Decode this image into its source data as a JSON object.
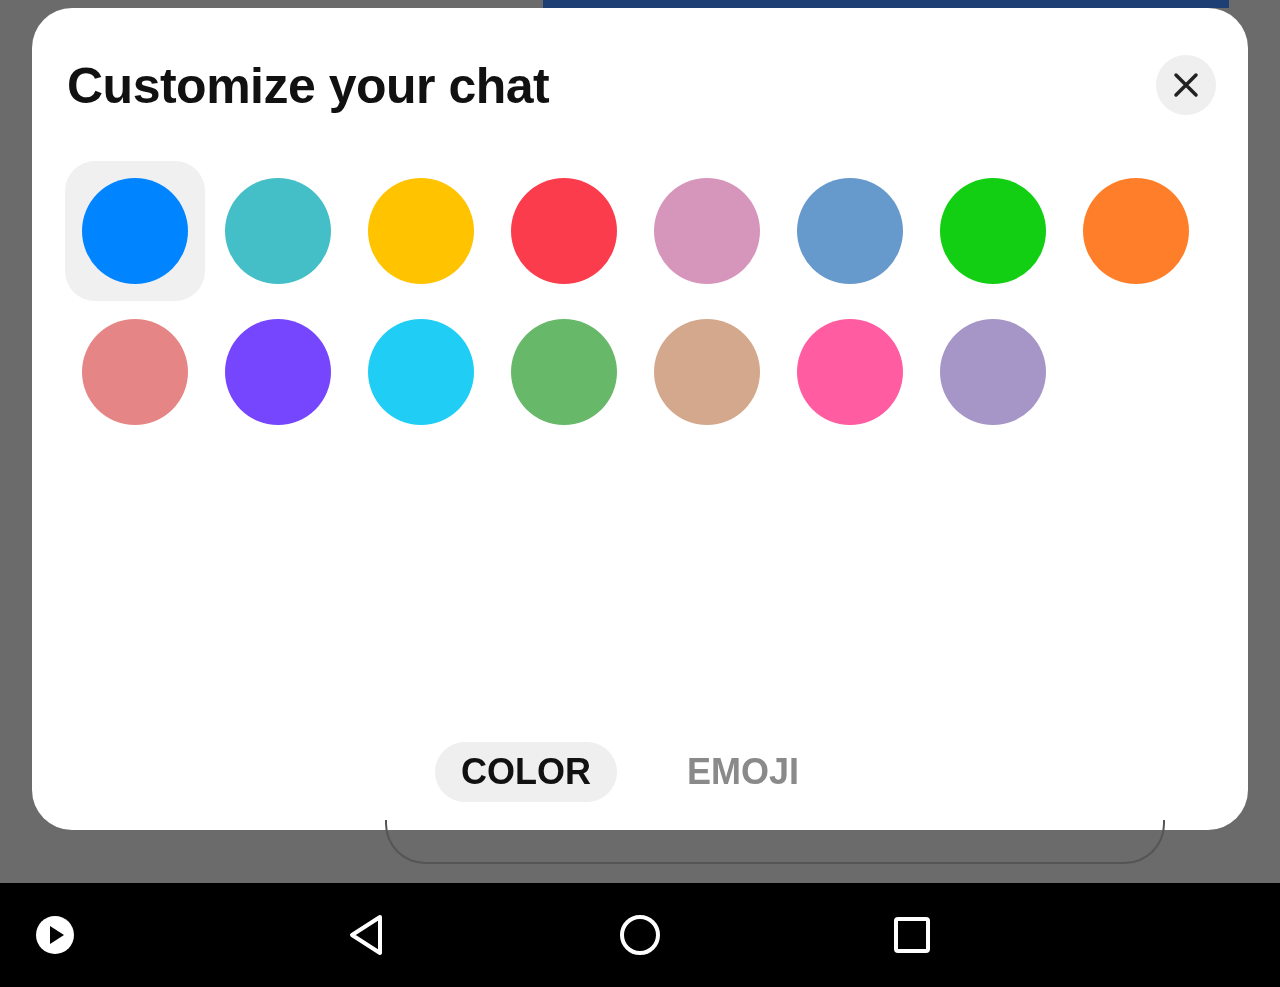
{
  "dialog": {
    "title": "Customize your chat"
  },
  "colors": [
    {
      "color": "#0084ff",
      "selected": true
    },
    {
      "color": "#44bec7",
      "selected": false
    },
    {
      "color": "#ffc300",
      "selected": false
    },
    {
      "color": "#fa3c4c",
      "selected": false
    },
    {
      "color": "#d696bb",
      "selected": false
    },
    {
      "color": "#6699cc",
      "selected": false
    },
    {
      "color": "#13cf13",
      "selected": false
    },
    {
      "color": "#ff7e29",
      "selected": false
    },
    {
      "color": "#e68585",
      "selected": false
    },
    {
      "color": "#7646ff",
      "selected": false
    },
    {
      "color": "#20cef5",
      "selected": false
    },
    {
      "color": "#67b868",
      "selected": false
    },
    {
      "color": "#d4a88c",
      "selected": false
    },
    {
      "color": "#ff5ca1",
      "selected": false
    },
    {
      "color": "#a695c7",
      "selected": false
    }
  ],
  "tabs": [
    {
      "label": "COLOR",
      "selected": true
    },
    {
      "label": "EMOJI",
      "selected": false
    }
  ]
}
